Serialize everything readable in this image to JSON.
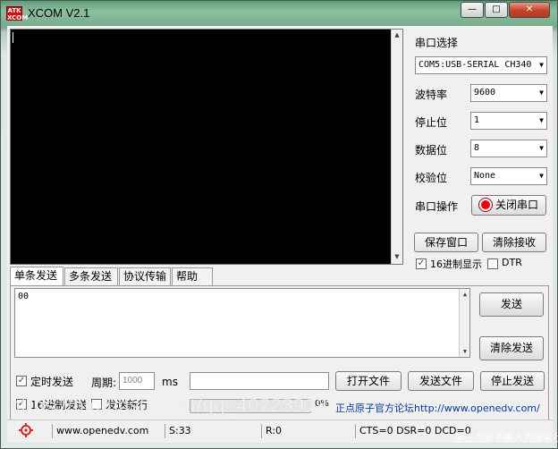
{
  "window": {
    "title": "XCOM V2.1",
    "logo_text": "ATK XCOM",
    "min_btn": "—",
    "max_btn": "□",
    "close_btn": "✕"
  },
  "serial": {
    "port_label": "串口选择",
    "port_value": "COM5:USB-SERIAL CH340",
    "baud_label": "波特率",
    "baud_value": "9600",
    "stop_label": "停止位",
    "stop_value": "1",
    "data_label": "数据位",
    "data_value": "8",
    "parity_label": "校验位",
    "parity_value": "None",
    "op_label": "串口操作",
    "op_button": "关闭串口"
  },
  "receive": {
    "save_button": "保存窗口",
    "clear_button": "清除接收",
    "hex_display_label": "16进制显示",
    "dtr_label": "DTR"
  },
  "tabs": [
    {
      "label": "单条发送"
    },
    {
      "label": "多条发送"
    },
    {
      "label": "协议传输"
    },
    {
      "label": "帮助"
    }
  ],
  "send": {
    "text": "00",
    "send_button": "发送",
    "clear_send_button": "清除发送",
    "timed_send_label": "定时发送",
    "period_label": "周期:",
    "period_value": "1000",
    "ms_label": "ms",
    "open_file_button": "打开文件",
    "send_file_button": "发送文件",
    "stop_send_button": "停止发送",
    "hex_send_label": "16进制发送",
    "newline_label": "发送新行",
    "progress_percent": "0%",
    "forum_link": "正点原子官方论坛http://www.openedv.com/"
  },
  "status": {
    "url": "www.openedv.com",
    "sent": "S:33",
    "received": "R:0",
    "lines": "CTS=0 DSR=0 DCD=0"
  },
  "watermark": {
    "text": "https://blog.csdn.net/qq_40223919",
    "corner": "@正点原子嵌入式技术社区"
  }
}
